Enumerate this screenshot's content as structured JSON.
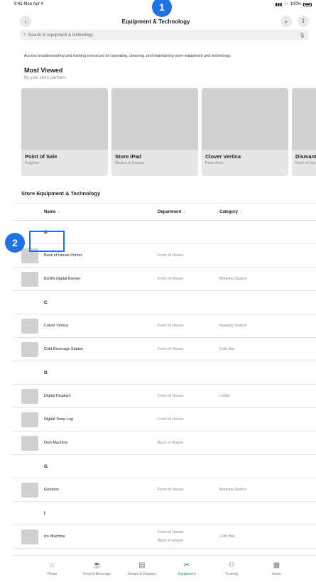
{
  "status": {
    "time": "9:41  Mon Apr 4",
    "battery": "100%"
  },
  "nav": {
    "back_icon": "chevron-left-icon",
    "title": "Equipment & Technology",
    "search_icon": "search-icon",
    "info_icon": "info-icon"
  },
  "search": {
    "placeholder": "Search in equipment & technology"
  },
  "intro": "Access troubleshooting and training resources for operating, cleaning, and maintaining store equipment and technology.",
  "most_viewed": {
    "title": "Most Viewed",
    "subtitle": "By your store partners",
    "cards": [
      {
        "title": "Point of Sale",
        "subtitle": "Register"
      },
      {
        "title": "Store iPad",
        "subtitle": "Device & Display"
      },
      {
        "title": "Clover Vertica",
        "subtitle": "Brew Area"
      },
      {
        "title": "Dismantle",
        "subtitle": "Back of House"
      }
    ]
  },
  "store_section": {
    "title": "Store Equipment & Technology",
    "headers": {
      "name": "Name",
      "department": "Department",
      "category": "Category",
      "sort_icon": "arrow-down-icon"
    },
    "rows": [
      {
        "type": "letter",
        "name": "B"
      },
      {
        "type": "item",
        "name": "Back of House Printer",
        "department": "Front of House",
        "category": ""
      },
      {
        "type": "item",
        "name": "BUNN Digital Brewer",
        "department": "Front of House",
        "category": "Brewing Station"
      },
      {
        "type": "letter",
        "name": "C"
      },
      {
        "type": "item",
        "name": "Colver Vertica",
        "department": "Front of House",
        "category": "Brewing Station"
      },
      {
        "type": "item",
        "name": "Cold Beverage Station",
        "department": "Front of House",
        "category": "Cold Bar"
      },
      {
        "type": "letter",
        "name": "D"
      },
      {
        "type": "item",
        "name": "Digital Displays",
        "department": "Front of House",
        "category": "Lobby"
      },
      {
        "type": "item",
        "name": "Digital Temp Log",
        "department": "Front of House",
        "category": ""
      },
      {
        "type": "item",
        "name": "Dish Machine",
        "department": "Back of House",
        "category": ""
      },
      {
        "type": "letter",
        "name": "G"
      },
      {
        "type": "item",
        "name": "Grinders",
        "department": "Front of House",
        "category": "Brewing Station"
      },
      {
        "type": "letter",
        "name": "I"
      },
      {
        "type": "item",
        "name": "Ice Machine",
        "department": "Front of House",
        "department2": "Back of House",
        "category": "Cold Bar"
      }
    ]
  },
  "tabs": [
    {
      "label": "Home",
      "icon": "house-icon",
      "glyph": "⌂",
      "active": false
    },
    {
      "label": "Food & Beverage",
      "icon": "cup-icon",
      "glyph": "☕",
      "active": false
    },
    {
      "label": "Setups & Displays",
      "icon": "clipboard-icon",
      "glyph": "▤",
      "active": false
    },
    {
      "label": "Equipment",
      "icon": "tools-icon",
      "glyph": "✂",
      "active": true
    },
    {
      "label": "Training",
      "icon": "people-icon",
      "glyph": "⚇",
      "active": false
    },
    {
      "label": "News",
      "icon": "newspaper-icon",
      "glyph": "▦",
      "active": false
    }
  ],
  "annotations": {
    "badge1": "1",
    "badge2": "2"
  }
}
